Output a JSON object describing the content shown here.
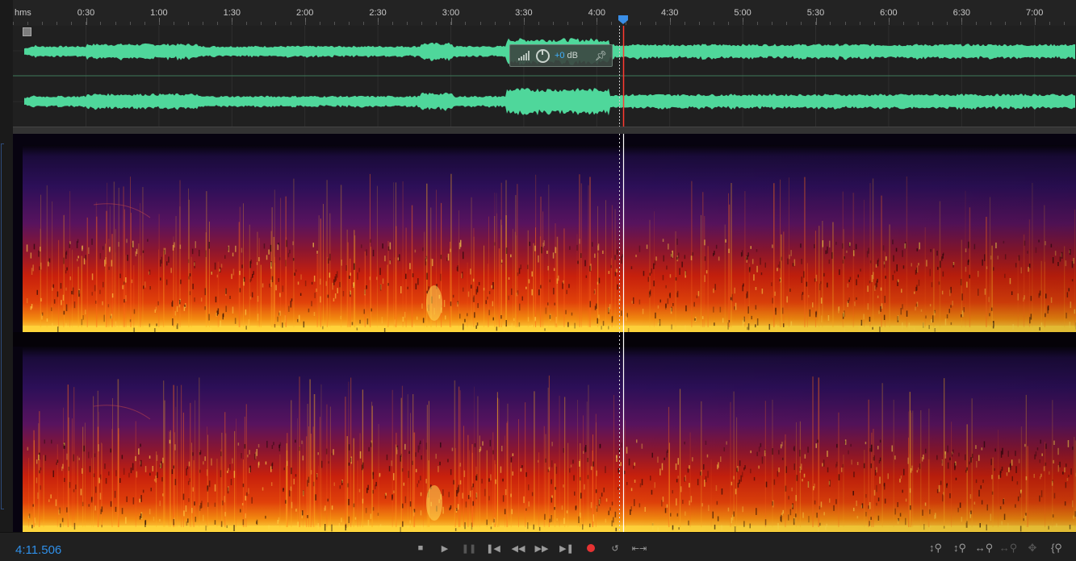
{
  "ruler": {
    "unit_label": "hms",
    "ticks": [
      "0:30",
      "1:00",
      "1:30",
      "2:00",
      "2:30",
      "3:00",
      "3:30",
      "4:00",
      "4:30",
      "5:00",
      "5:30",
      "6:00",
      "6:30",
      "7:00"
    ]
  },
  "hud": {
    "gain_value": "+0",
    "gain_unit": "dB"
  },
  "transport": {
    "timecode": "4:11.506"
  },
  "colors": {
    "waveform": "#4fd79b",
    "playhead": "#ff3b30",
    "timecode": "#2f8fe8",
    "accent_blue": "#3a8ee6"
  },
  "icons": {
    "stop": "stop-icon",
    "play": "play-icon",
    "pause": "pause-icon",
    "to_start": "skip-to-start-icon",
    "rewind": "rewind-icon",
    "fast_forward": "fast-forward-icon",
    "to_end": "skip-to-end-icon",
    "record": "record-icon",
    "loop": "loop-playback-icon",
    "skip_selection": "skip-selection-icon",
    "zoom_in_amplitude": "zoom-in-amplitude-icon",
    "zoom_out_amplitude": "zoom-out-amplitude-icon",
    "zoom_in_time": "zoom-in-time-icon",
    "zoom_out_time": "zoom-out-time-icon",
    "zoom_full": "zoom-full-icon",
    "zoom_selection": "zoom-selection-icon"
  }
}
